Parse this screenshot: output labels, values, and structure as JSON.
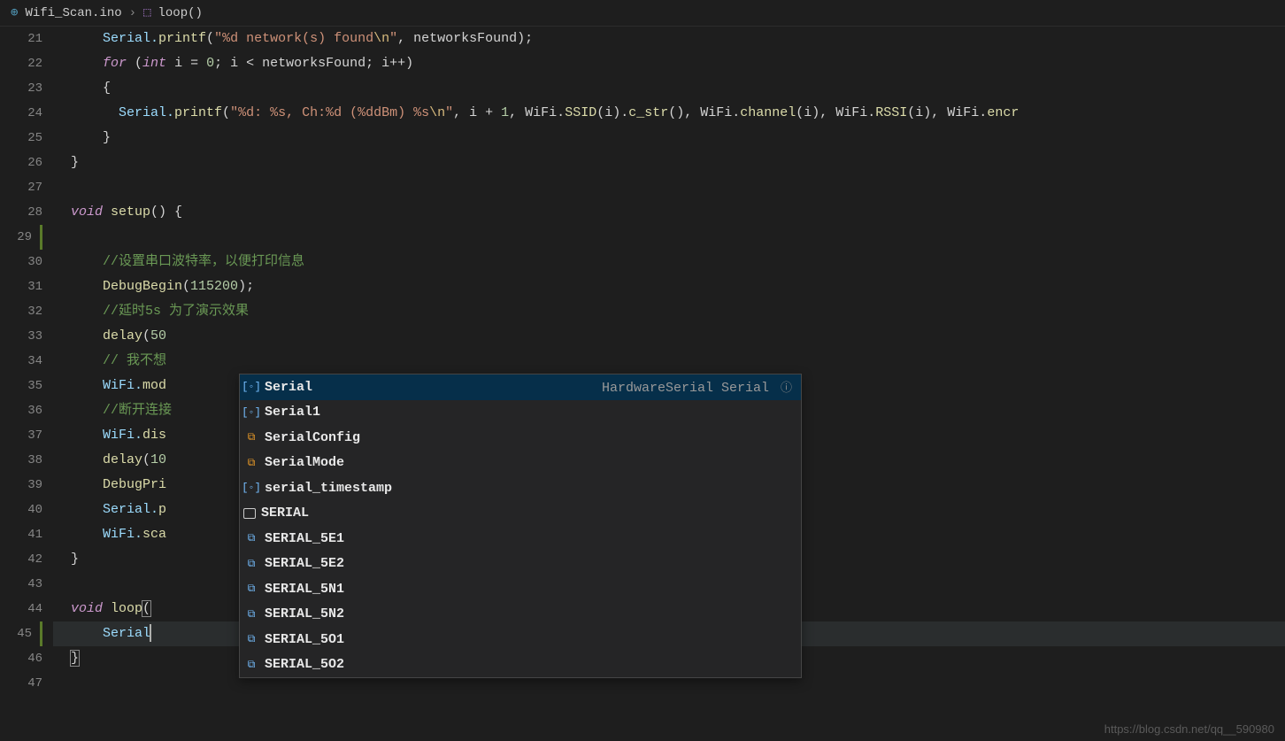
{
  "breadcrumb": {
    "file": "Wifi_Scan.ino",
    "symbol": "loop()"
  },
  "gutter": {
    "start": 21,
    "end": 47,
    "modified": [
      29,
      45
    ]
  },
  "code": {
    "l21_pre": "    Serial.",
    "l21_fn": "printf",
    "l21_open": "(",
    "l21_str1": "\"%d network(s) found",
    "l21_esc": "\\n",
    "l21_str2": "\"",
    "l21_mid": ", networksFound);",
    "l22_for": "for",
    "l22_open": " (",
    "l22_int": "int",
    "l22_rest": " i = ",
    "l22_zero": "0",
    "l22_mid": "; i < networksFound; i++)",
    "l23": "    {",
    "l24_pre": "      Serial.",
    "l24_fn": "printf",
    "l24_open": "(",
    "l24_str": "\"%d: %s, Ch:%d (%ddBm) %s",
    "l24_esc": "\\n",
    "l24_strend": "\"",
    "l24_mid1": ", i + ",
    "l24_one": "1",
    "l24_mid2": ", WiFi.",
    "l24_ssid": "SSID",
    "l24_mid3": "(i).",
    "l24_cstr": "c_str",
    "l24_mid4": "(), WiFi.",
    "l24_chan": "channel",
    "l24_mid5": "(i), WiFi.",
    "l24_rssi": "RSSI",
    "l24_mid6": "(i), WiFi.",
    "l24_enc": "encr",
    "l25": "    }",
    "l26": "}",
    "l28_void": "void",
    "l28_sp": " ",
    "l28_fn": "setup",
    "l28_rest": "() {",
    "l30": "    //设置串口波特率，以便打印信息",
    "l31_pre": "    ",
    "l31_fn": "DebugBegin",
    "l31_open": "(",
    "l31_num": "115200",
    "l31_close": ");",
    "l32": "    //延时5s 为了演示效果",
    "l33_pre": "    ",
    "l33_fn": "delay",
    "l33_open": "(",
    "l33_num": "50",
    "l34": "    // 我不想",
    "l35_pre": "    WiFi.",
    "l35_fn": "mod",
    "l36": "    //断开连接",
    "l37_pre": "    WiFi.",
    "l37_fn": "dis",
    "l38_pre": "    ",
    "l38_fn": "delay",
    "l38_open": "(",
    "l38_num": "10",
    "l39_pre": "    ",
    "l39_fn": "DebugPri",
    "l40_pre": "    Serial.",
    "l40_fn": "p",
    "l41_pre": "    WiFi.",
    "l41_fn": "sca",
    "l42": "}",
    "l44_void": "void",
    "l44_sp": " ",
    "l44_fn": "loop",
    "l44_rest": "(",
    "l45": "    Serial",
    "l46": "}"
  },
  "suggest": {
    "detail": "HardwareSerial Serial",
    "items": [
      {
        "icon": "variable",
        "label": "Serial"
      },
      {
        "icon": "variable",
        "label": "Serial1"
      },
      {
        "icon": "enum",
        "label": "SerialConfig"
      },
      {
        "icon": "enum",
        "label": "SerialMode"
      },
      {
        "icon": "variable",
        "label": "serial_timestamp"
      },
      {
        "icon": "keyword",
        "label": "SERIAL"
      },
      {
        "icon": "constant",
        "label": "SERIAL_5E1"
      },
      {
        "icon": "constant",
        "label": "SERIAL_5E2"
      },
      {
        "icon": "constant",
        "label": "SERIAL_5N1"
      },
      {
        "icon": "constant",
        "label": "SERIAL_5N2"
      },
      {
        "icon": "constant",
        "label": "SERIAL_5O1"
      },
      {
        "icon": "constant",
        "label": "SERIAL_5O2"
      }
    ]
  },
  "watermark": "https://blog.csdn.net/qq__590980"
}
